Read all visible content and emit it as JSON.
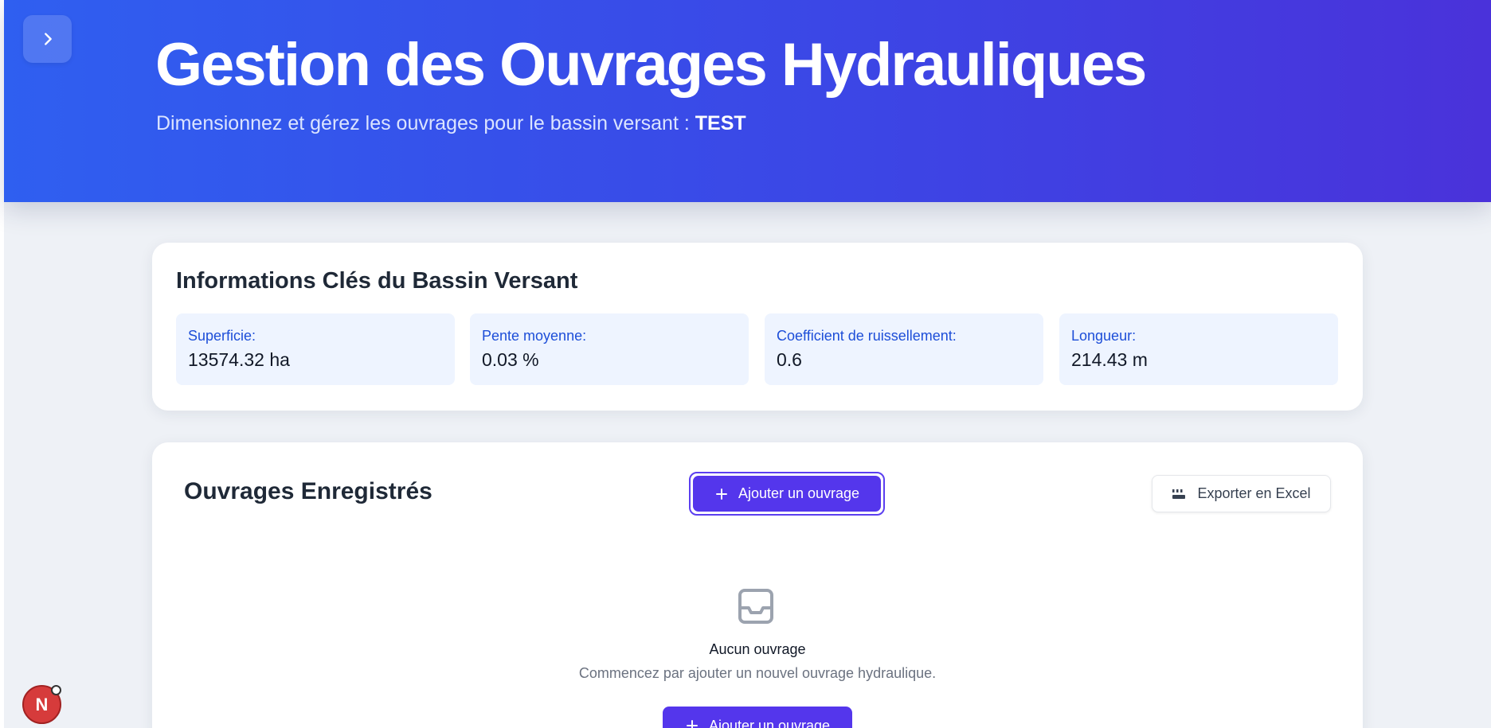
{
  "header": {
    "toggle_icon": "chevron-right-icon",
    "title": "Gestion des Ouvrages Hydrauliques",
    "subtitle_prefix": "Dimensionnez et gérez les ouvrages pour le bassin versant : ",
    "basin_name": "TEST",
    "gradient_start": "#2f5ff0",
    "gradient_end": "#4a32da"
  },
  "basin_info": {
    "title": "Informations Clés du Bassin Versant",
    "stats": [
      {
        "label": "Superficie:",
        "value": "13574.32 ha"
      },
      {
        "label": "Pente moyenne:",
        "value": "0.03 %"
      },
      {
        "label": "Coefficient de ruissellement:",
        "value": "0.6"
      },
      {
        "label": "Longueur:",
        "value": "214.43 m"
      }
    ]
  },
  "works": {
    "title": "Ouvrages Enregistrés",
    "add_button_label": "Ajouter un ouvrage",
    "add_button_icon": "plus-icon",
    "export_button_label": "Exporter en Excel",
    "export_button_icon": "excel-icon",
    "empty_icon": "inbox-icon",
    "empty_title": "Aucun ouvrage",
    "empty_description": "Commencez par ajouter un nouvel ouvrage hydraulique.",
    "empty_add_button_label": "Ajouter un ouvrage",
    "accent_color": "#5436ec"
  },
  "dev_badge": {
    "letter": "N",
    "color": "#d63b3b"
  }
}
